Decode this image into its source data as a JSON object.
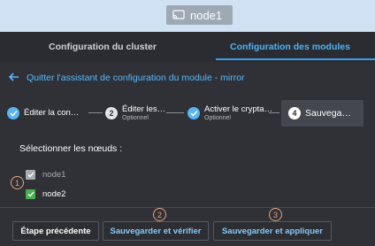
{
  "window": {
    "node_label": "node1"
  },
  "tabs": [
    {
      "label": "Configuration du cluster",
      "active": false
    },
    {
      "label": "Configuration des modules",
      "active": true
    }
  ],
  "back_link": {
    "label": "Quitter l'assistant de configuration du module - mirror"
  },
  "steps": [
    {
      "label": "Éditer la con…",
      "subtitle": "",
      "state": "done",
      "number": ""
    },
    {
      "label": "Éditer les…",
      "subtitle": "Optionnel",
      "state": "pending",
      "number": "2"
    },
    {
      "label": "Activer le crypta…",
      "subtitle": "Optionnel",
      "state": "done",
      "number": ""
    },
    {
      "label": "Sauvega…",
      "subtitle": "",
      "state": "active",
      "number": "4"
    }
  ],
  "node_select": {
    "title": "Sélectionner les nœuds :",
    "nodes": [
      {
        "label": "node1",
        "checked": true,
        "disabled": true
      },
      {
        "label": "node2",
        "checked": true,
        "disabled": false
      }
    ]
  },
  "annotations": {
    "badge1": "1",
    "badge2": "2",
    "badge3": "3"
  },
  "buttons": {
    "prev": "Étape précédente",
    "save_verify": "Sauvegarder et vérifier",
    "save_apply": "Sauvegarder et appliquer"
  },
  "colors": {
    "accent": "#3aa0f0",
    "topbar": "#cfe1f3",
    "background": "#2f3136",
    "success": "#4caf50",
    "annotation": "#e7a57b"
  }
}
